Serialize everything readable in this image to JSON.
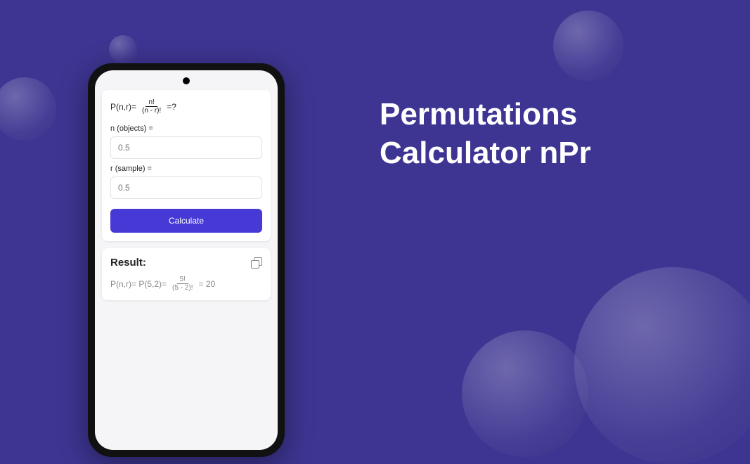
{
  "headline": {
    "line1": "Permutations",
    "line2": "Calculator nPr"
  },
  "formula": {
    "lhs": "P(n,r)=",
    "frac_num": "n!",
    "frac_den": "(n - r)!",
    "tail": "=?"
  },
  "fields": {
    "n_label": "n (objects) =",
    "n_placeholder": "0.5",
    "r_label": "r (sample) =",
    "r_placeholder": "0.5"
  },
  "actions": {
    "calculate": "Calculate"
  },
  "result": {
    "title": "Result:",
    "prefix": "P(n,r)= P(5,2)=",
    "frac_num": "5!",
    "frac_den": "(5 - 2)!",
    "equals": "= 20"
  }
}
